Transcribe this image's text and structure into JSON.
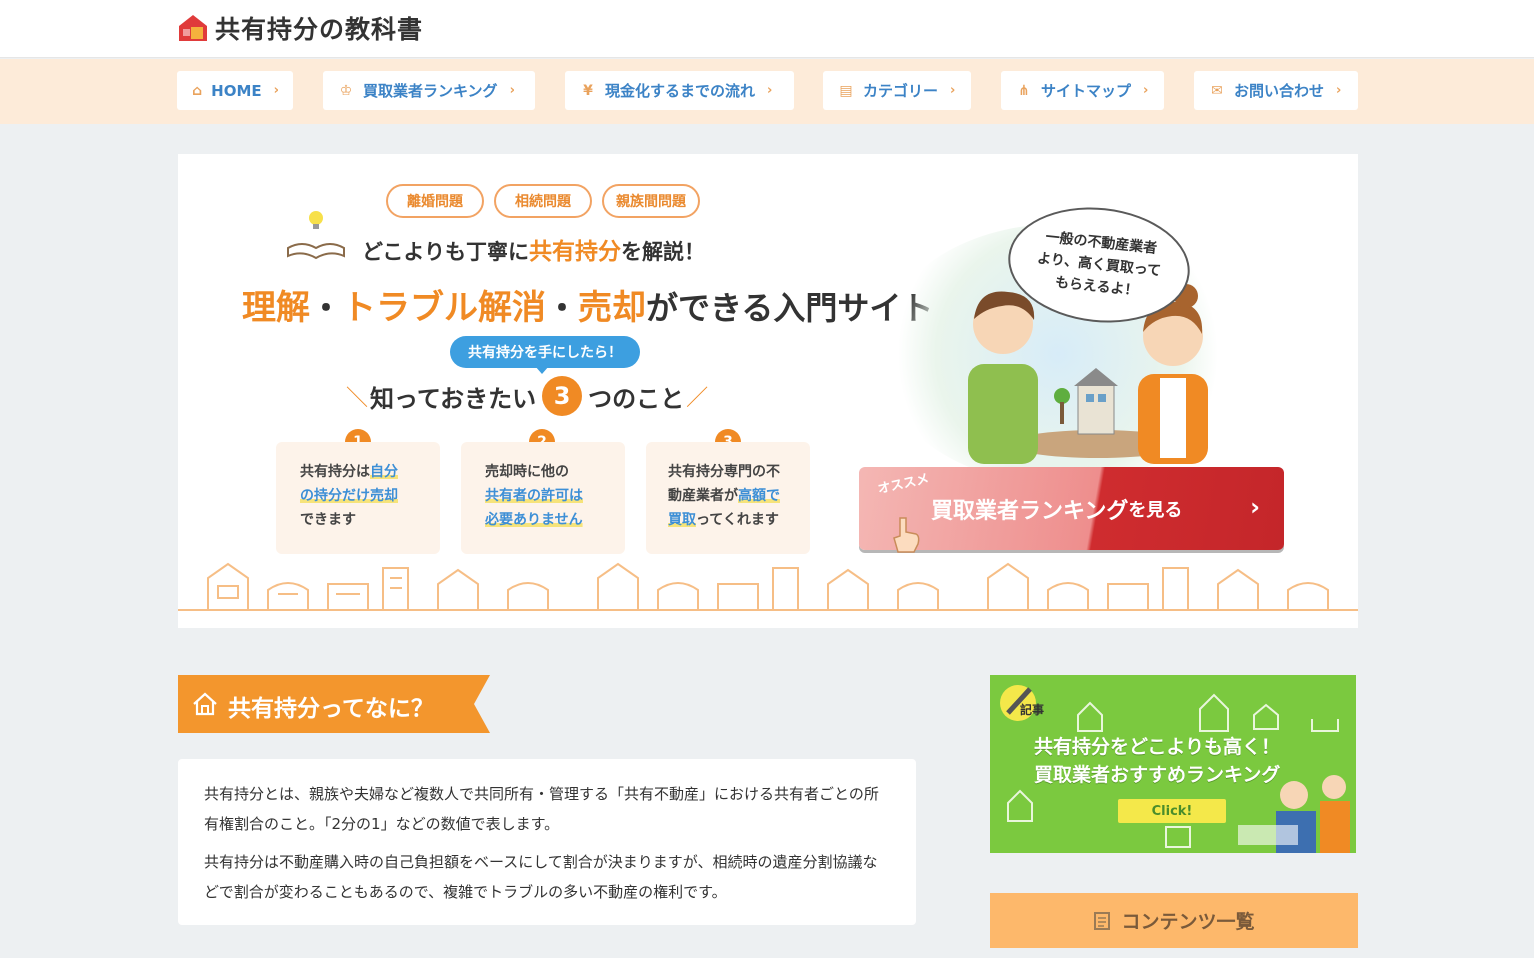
{
  "header": {
    "site_title": "共有持分の教科書"
  },
  "nav": {
    "items": [
      {
        "label": "HOME",
        "icon": "home-icon"
      },
      {
        "label": "買取業者ランキング",
        "icon": "crown-icon"
      },
      {
        "label": "現金化するまでの流れ",
        "icon": "money-bag-icon"
      },
      {
        "label": "カテゴリー",
        "icon": "document-icon"
      },
      {
        "label": "サイトマップ",
        "icon": "sitemap-icon"
      },
      {
        "label": "お問い合わせ",
        "icon": "mail-icon"
      }
    ]
  },
  "hero": {
    "tags": [
      "離婚問題",
      "相続問題",
      "親族間問題"
    ],
    "lead_pre": "どこよりも丁寧に",
    "lead_hl": "共有持分",
    "lead_post": "を解説！",
    "headline_hl1": "理解",
    "headline_dot1": "・",
    "headline_hl2": "トラブル解消",
    "headline_dot2": "・",
    "headline_hl3": "売却",
    "headline_post": "ができる入門サイト",
    "pill": "共有持分を手にしたら！",
    "know_pre": "知っておきたい",
    "know_num": "3",
    "know_post": "つのこと",
    "cards": [
      {
        "num": "1",
        "l1a": "共有持分は",
        "l1b": "自分",
        "l2": "の持分だけ売却",
        "l3": "できます"
      },
      {
        "num": "2",
        "l1": "売却時に他の",
        "l2": "共有者の許可は",
        "l3": "必要ありません"
      },
      {
        "num": "3",
        "l1": "共有持分専門の不",
        "l2a": "動産業者が",
        "l2b": "高額で",
        "l3a": "買取",
        "l3b": "ってくれます"
      }
    ],
    "bubble": [
      "一般の不動産業者",
      "より、高く買取って",
      "もらえるよ！"
    ],
    "cta_badge": "オススメ",
    "cta_main": "買取業者ランキング",
    "cta_small": "を見る"
  },
  "section": {
    "title": "共有持分ってなに？",
    "p1": "共有持分とは、親族や夫婦など複数人で共同所有・管理する「共有不動産」における共有者ごとの所有権割合のこと。「2分の1」などの数値で表します。",
    "p2": "共有持分は不動産購入時の自己負担額をベースにして割合が決まりますが、相続時の遺産分割協議などで割合が変わることもあるので、複雑でトラブルの多い不動産の権利です。"
  },
  "sidebar": {
    "banner_kiji": "記事",
    "banner_line1": "共有持分をどこよりも高く！",
    "banner_line2": "買取業者おすすめランキング",
    "banner_click": "Click!",
    "contents_heading": "コンテンツ一覧"
  },
  "colors": {
    "accent_orange": "#f08a24",
    "nav_bg": "#fdebd9",
    "link_blue": "#3c83c6",
    "banner_green": "#7bc93f",
    "cta_red": "#c4262a"
  }
}
